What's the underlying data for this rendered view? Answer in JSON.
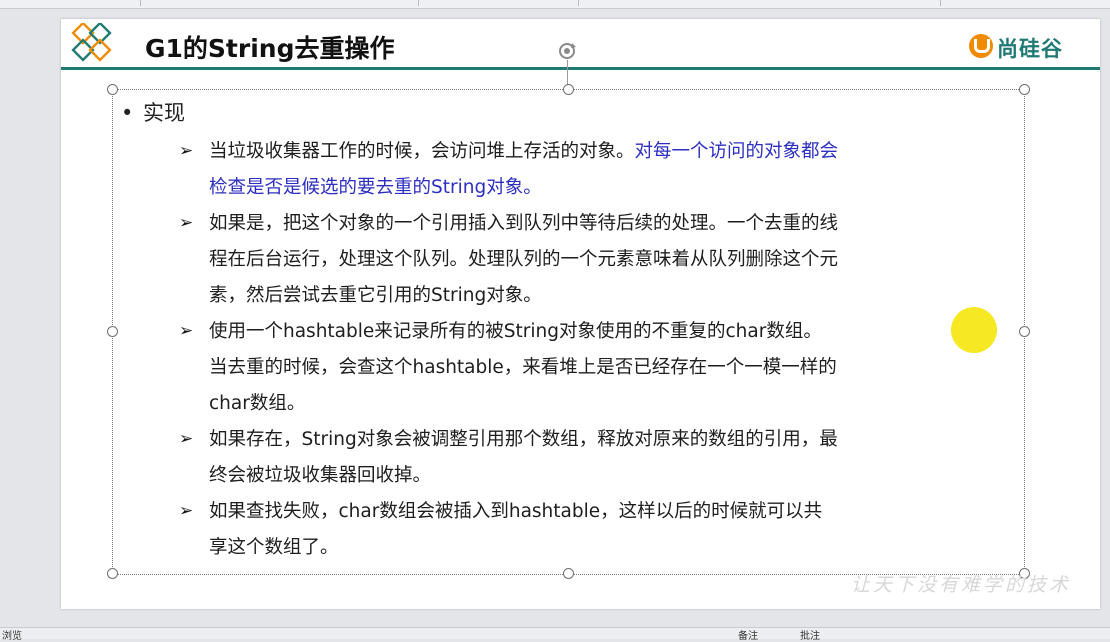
{
  "slide": {
    "title": "G1的String去重操作",
    "brand": "尚硅谷",
    "watermark": "让天下没有难学的技术",
    "colors": {
      "accent": "#1f7a73",
      "logo": "#f08a00",
      "highlight_text": "#2c2fbf",
      "pointer": "#f5e60b"
    },
    "bullet": "实现",
    "items": [
      {
        "lines": [
          {
            "parts": [
              {
                "text": "当垃圾收集器工作的时候，会访问堆上存活的对象。"
              },
              {
                "text": "对每一个访问的对象都会",
                "color": "blue"
              }
            ]
          },
          {
            "parts": [
              {
                "text": "检查是否是候选的要去重的String对象。",
                "color": "blue"
              }
            ]
          }
        ]
      },
      {
        "lines": [
          {
            "parts": [
              {
                "text": "如果是，把这个对象的一个引用插入到队列中等待后续的处理。一个去重的线"
              }
            ]
          },
          {
            "parts": [
              {
                "text": "程在后台运行，处理这个队列。处理队列的一个元素意味着从队列删除这个元"
              }
            ]
          },
          {
            "parts": [
              {
                "text": "素，然后尝试去重它引用的String对象。"
              }
            ]
          }
        ]
      },
      {
        "lines": [
          {
            "parts": [
              {
                "text": "使用一个hashtable来记录所有的被String对象使用的不重复的char数组。"
              }
            ]
          },
          {
            "parts": [
              {
                "text": "当去重的时候，会查这个hashtable，来看堆上是否已经存在一个一模一样的"
              }
            ]
          },
          {
            "parts": [
              {
                "text": "char数组。"
              }
            ]
          }
        ]
      },
      {
        "lines": [
          {
            "parts": [
              {
                "text": "如果存在，String对象会被调整引用那个数组，释放对原来的数组的引用，最"
              }
            ]
          },
          {
            "parts": [
              {
                "text": "终会被垃圾收集器回收掉。"
              }
            ]
          }
        ]
      },
      {
        "lines": [
          {
            "parts": [
              {
                "text": "如果查找失败，char数组会被插入到hashtable，这样以后的时候就可以共"
              }
            ]
          },
          {
            "parts": [
              {
                "text": "享这个数组了。"
              }
            ]
          }
        ]
      }
    ]
  },
  "status_bar": {
    "left": "浏览",
    "notes": "备注",
    "comments": "批注"
  }
}
